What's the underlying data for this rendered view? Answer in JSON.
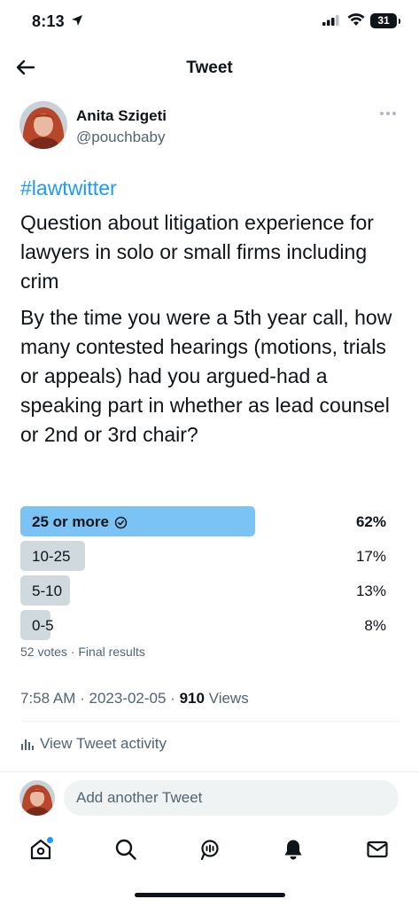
{
  "status_bar": {
    "time": "8:13",
    "battery": "31"
  },
  "header": {
    "title": "Tweet"
  },
  "author": {
    "name": "Anita Szigeti",
    "handle": "@pouchbaby"
  },
  "tweet": {
    "hashtag": "#lawtwitter",
    "paragraph1": "Question about litigation experience for lawyers in solo or small firms including crim",
    "paragraph2": "By the time you were a 5th year call, how many contested hearings (motions, trials or appeals) had you argued-had a speaking part in whether as lead counsel or 2nd or 3rd chair?"
  },
  "poll": {
    "options": [
      {
        "label": "25 or more",
        "percent": 62,
        "percent_text": "62%",
        "winner": true
      },
      {
        "label": "10-25",
        "percent": 17,
        "percent_text": "17%",
        "winner": false
      },
      {
        "label": "5-10",
        "percent": 13,
        "percent_text": "13%",
        "winner": false
      },
      {
        "label": "0-5",
        "percent": 8,
        "percent_text": "8%",
        "winner": false
      }
    ],
    "meta": "52 votes · Final results"
  },
  "timestamp": {
    "time": "7:58 AM",
    "date": "2023-02-05",
    "views_count": "910",
    "views_label": "Views"
  },
  "activity": {
    "label": "View Tweet activity"
  },
  "reply": {
    "placeholder": "Add another Tweet"
  },
  "colors": {
    "accent": "#1d9bf0",
    "winner_bar": "#7cc3f5",
    "loser_bar": "#cfd9de",
    "secondary_text": "#536471"
  },
  "icons": [
    "location-arrow-icon",
    "signal-icon",
    "wifi-icon",
    "back-arrow-icon",
    "more-icon",
    "check-circle-icon",
    "bar-chart-icon",
    "home-icon",
    "search-icon",
    "spaces-icon",
    "bell-icon",
    "mail-icon"
  ]
}
